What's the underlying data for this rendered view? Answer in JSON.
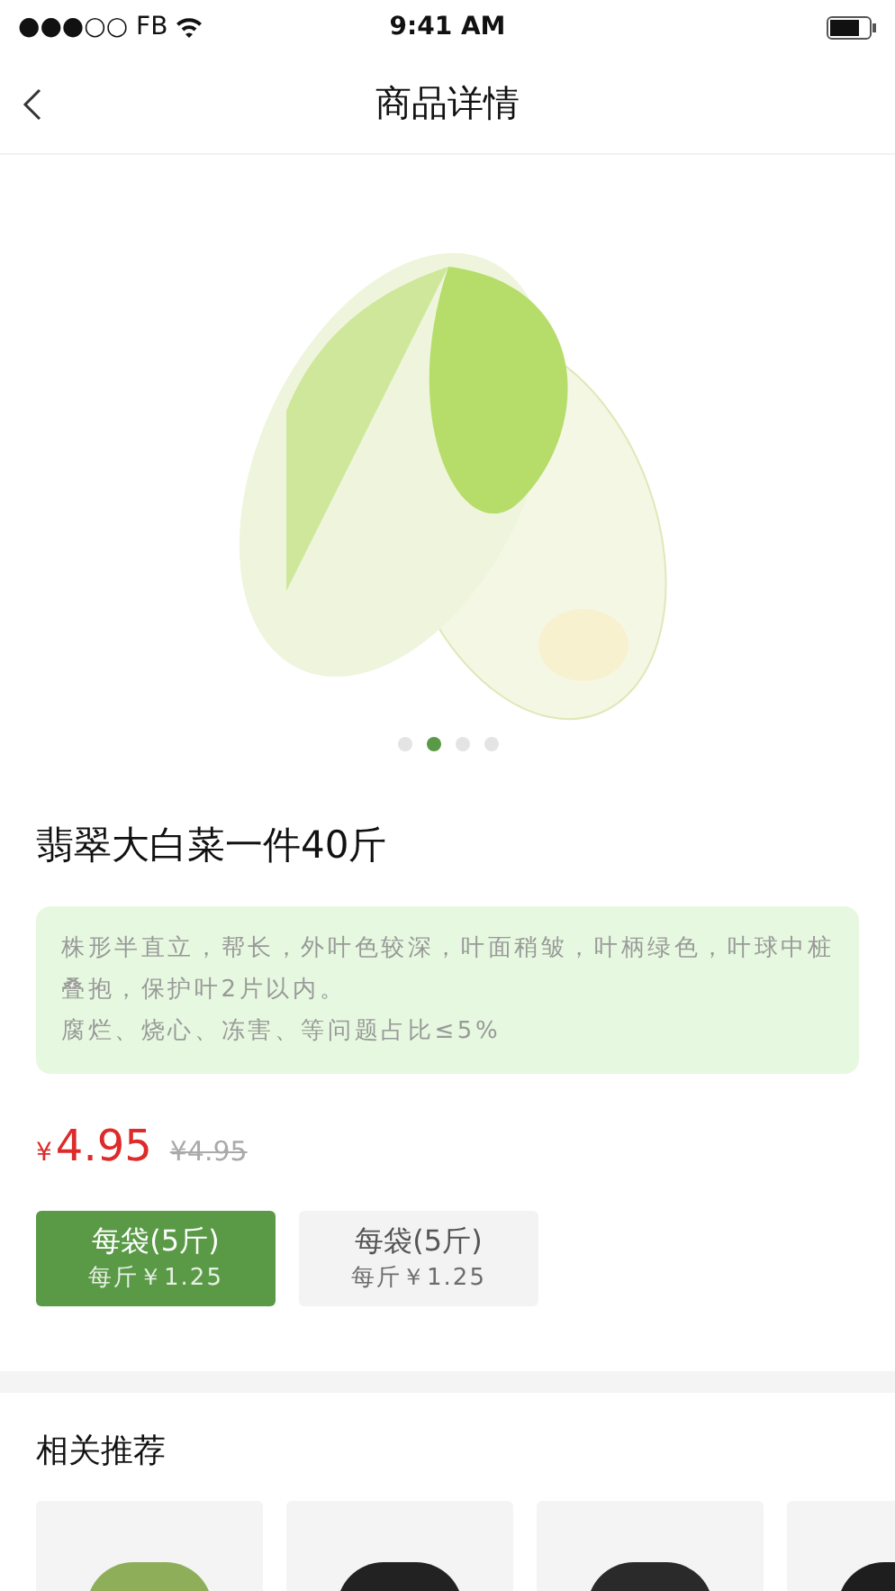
{
  "status_bar": {
    "carrier": "●●●○○ FB",
    "time": "9:41 AM"
  },
  "nav": {
    "title": "商品详情"
  },
  "gallery": {
    "dots": [
      {
        "selected": false
      },
      {
        "selected": true
      },
      {
        "selected": false
      },
      {
        "selected": false
      }
    ]
  },
  "product": {
    "name": "翡翠大白菜一件40斤",
    "description": [
      "株形半直立，帮长，外叶色较深，叶面稍皱，叶柄绿色，叶球中桩叠抱，保护叶2片以内。",
      "腐烂、烧心、冻害、等问题占比≤5%"
    ],
    "currency": "¥",
    "price": "4.95",
    "original_price": "¥4.95"
  },
  "options": [
    {
      "label": "每袋(5斤)",
      "unit_price": "每斤￥1.25",
      "selected": true
    },
    {
      "label": "每袋(5斤)",
      "unit_price": "每斤￥1.25",
      "selected": false
    }
  ],
  "recommendations": {
    "title": "相关推荐",
    "items": [
      {
        "color": "#8fae5a"
      },
      {
        "color": "#222222"
      },
      {
        "color": "#2a2a2a"
      },
      {
        "color": "#1e1e1e"
      }
    ]
  }
}
